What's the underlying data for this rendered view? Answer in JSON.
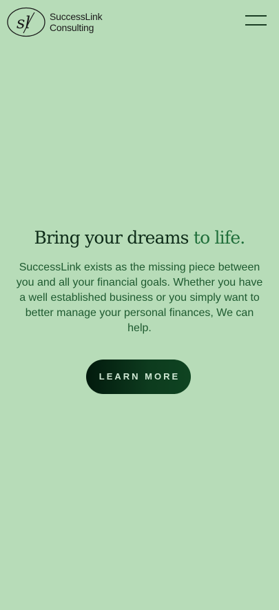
{
  "header": {
    "logo_monogram": "sl",
    "logo_line1": "SuccessLink",
    "logo_line2": "Consulting",
    "menu_icon": "hamburger-menu-icon"
  },
  "hero": {
    "title_main": "Bring your dreams",
    "title_accent": "to life.",
    "description": "SuccessLink exists as the missing piece between you and all your financial goals. Whether you have a well established business or you simply want to better manage your personal finances, We can help.",
    "cta_label": "LEARN MORE"
  },
  "colors": {
    "background": "#b7dcb8",
    "title": "#0d2b18",
    "title_accent": "#1f6e3a",
    "body_text": "#1e5a30",
    "button": "#021a0d",
    "button_text": "#cfe7d3"
  }
}
